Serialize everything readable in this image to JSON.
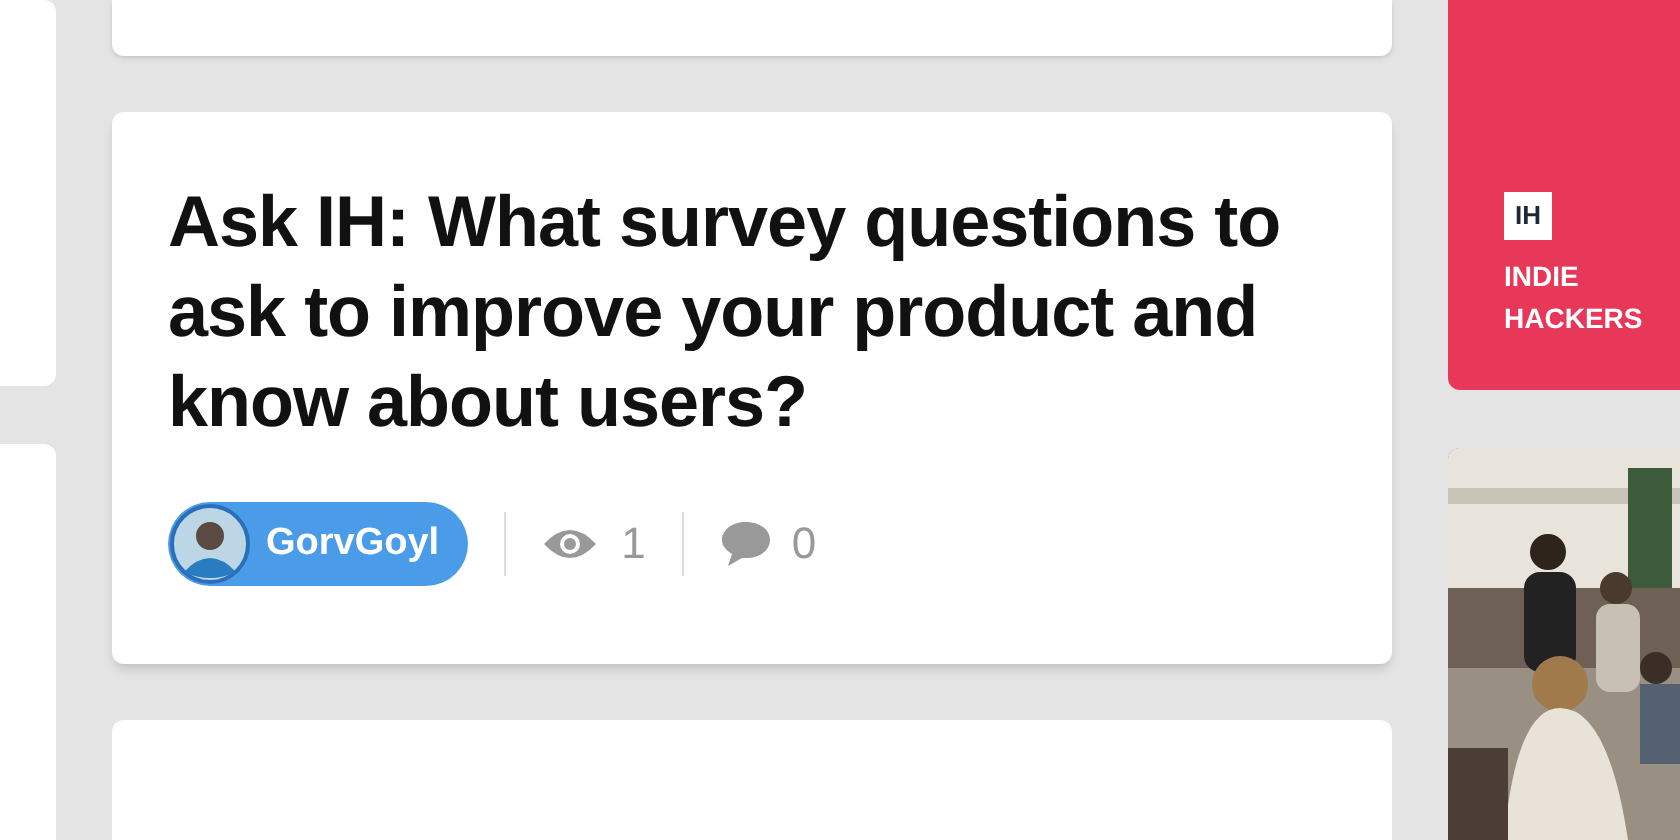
{
  "post": {
    "title": "Ask IH: What survey questions to ask to improve your product and know about users?",
    "author": "GorvGoyl",
    "views": "1",
    "comments": "0"
  },
  "sidebar_brand": {
    "logo": "IH",
    "name_lines": [
      "INDIE",
      "HACKERS"
    ]
  }
}
